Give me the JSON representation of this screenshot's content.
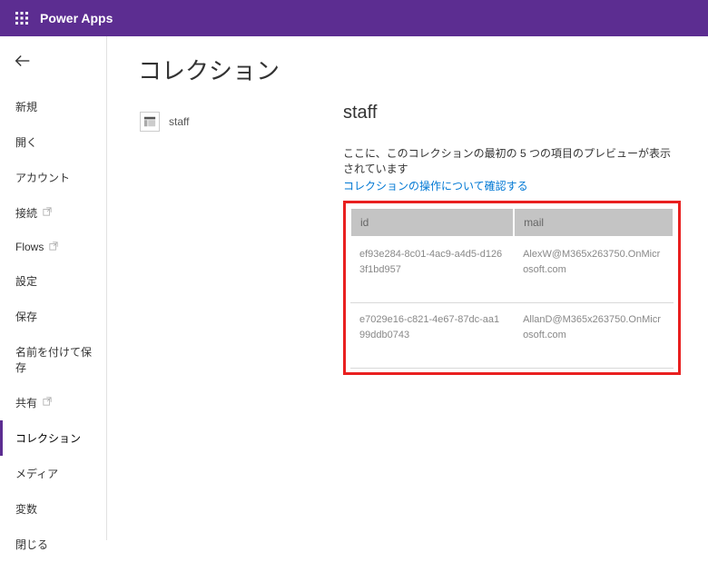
{
  "app": {
    "title": "Power Apps"
  },
  "page": {
    "title": "コレクション"
  },
  "sidebar": {
    "items": [
      {
        "label": "新規",
        "ext": false
      },
      {
        "label": "開く",
        "ext": false
      },
      {
        "label": "アカウント",
        "ext": false
      },
      {
        "label": "接続",
        "ext": true
      },
      {
        "label": "Flows",
        "ext": true
      },
      {
        "label": "設定",
        "ext": false
      },
      {
        "label": "保存",
        "ext": false
      },
      {
        "label": "名前を付けて保存",
        "ext": false
      },
      {
        "label": "共有",
        "ext": true
      },
      {
        "label": "コレクション",
        "ext": false,
        "active": true
      },
      {
        "label": "メディア",
        "ext": false
      },
      {
        "label": "変数",
        "ext": false
      },
      {
        "label": "閉じる",
        "ext": false
      }
    ]
  },
  "collections": {
    "items": [
      {
        "name": "staff"
      }
    ],
    "selected": {
      "name": "staff",
      "previewText": "ここに、このコレクションの最初の 5 つの項目のプレビューが表示されています",
      "helpLink": "コレクションの操作について確認する",
      "columns": [
        "id",
        "mail"
      ],
      "rows": [
        {
          "id": "ef93e284-8c01-4ac9-a4d5-d1263f1bd957",
          "mail": "AlexW@M365x263750.OnMicrosoft.com"
        },
        {
          "id": "e7029e16-c821-4e67-87dc-aa199ddb0743",
          "mail": "AllanD@M365x263750.OnMicrosoft.com"
        }
      ]
    }
  }
}
